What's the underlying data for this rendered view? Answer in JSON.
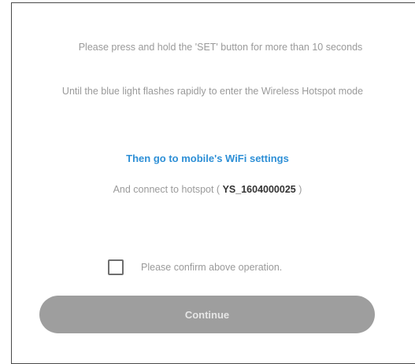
{
  "instructions": {
    "line1": "Please press and hold the 'SET' button for more than 10 seconds",
    "line2": "Until the blue light flashes rapidly to enter the Wireless Hotspot mode"
  },
  "wifi_link": "Then go to mobile's WiFi settings",
  "hotspot": {
    "prefix": "And connect to hotspot (",
    "id": "YS_1604000025",
    "suffix": ")"
  },
  "confirm": {
    "label": "Please confirm above operation.",
    "checked": false
  },
  "continue_button": "Continue",
  "colors": {
    "link": "#2d8fd6",
    "button_disabled": "#9e9e9e",
    "muted_text": "#9a9a9a"
  }
}
